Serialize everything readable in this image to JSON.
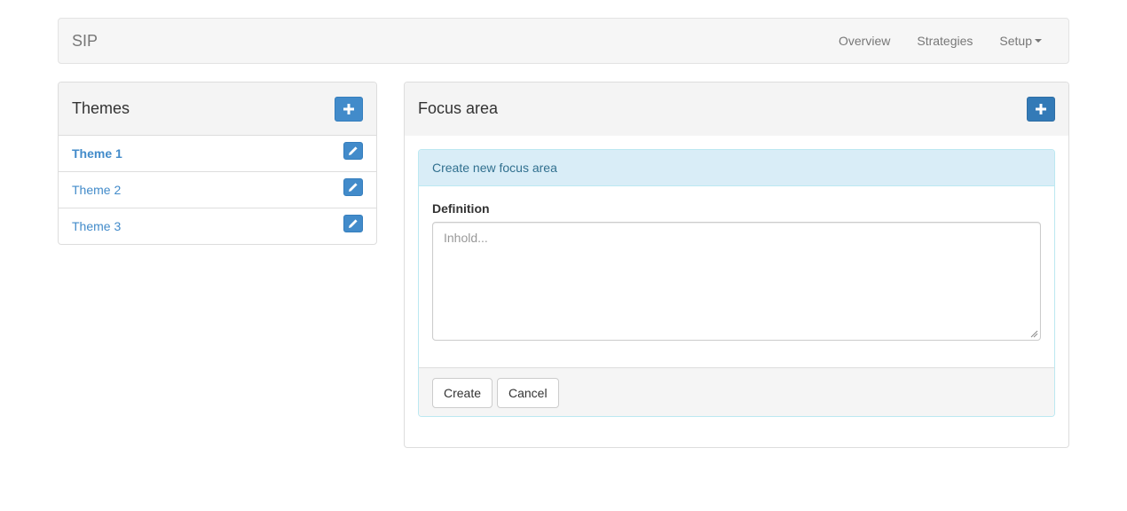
{
  "navbar": {
    "brand": "SIP",
    "items": [
      {
        "label": "Overview"
      },
      {
        "label": "Strategies"
      },
      {
        "label": "Setup"
      }
    ]
  },
  "themes_panel": {
    "title": "Themes",
    "add_icon": "plus-icon",
    "items": [
      {
        "label": "Theme 1",
        "active": true,
        "edit_icon": "pencil-icon"
      },
      {
        "label": "Theme 2",
        "active": false,
        "edit_icon": "pencil-icon"
      },
      {
        "label": "Theme 3",
        "active": false,
        "edit_icon": "pencil-icon"
      }
    ]
  },
  "focus_panel": {
    "title": "Focus area",
    "add_icon": "plus-icon",
    "form": {
      "heading": "Create new focus area",
      "definition_label": "Definition",
      "definition_value": "",
      "definition_placeholder": "Inhold...",
      "create_label": "Create",
      "cancel_label": "Cancel"
    }
  },
  "colors": {
    "primary": "#428bca",
    "link": "#428bca",
    "info_bg": "#d9edf7",
    "info_text": "#31708f"
  }
}
